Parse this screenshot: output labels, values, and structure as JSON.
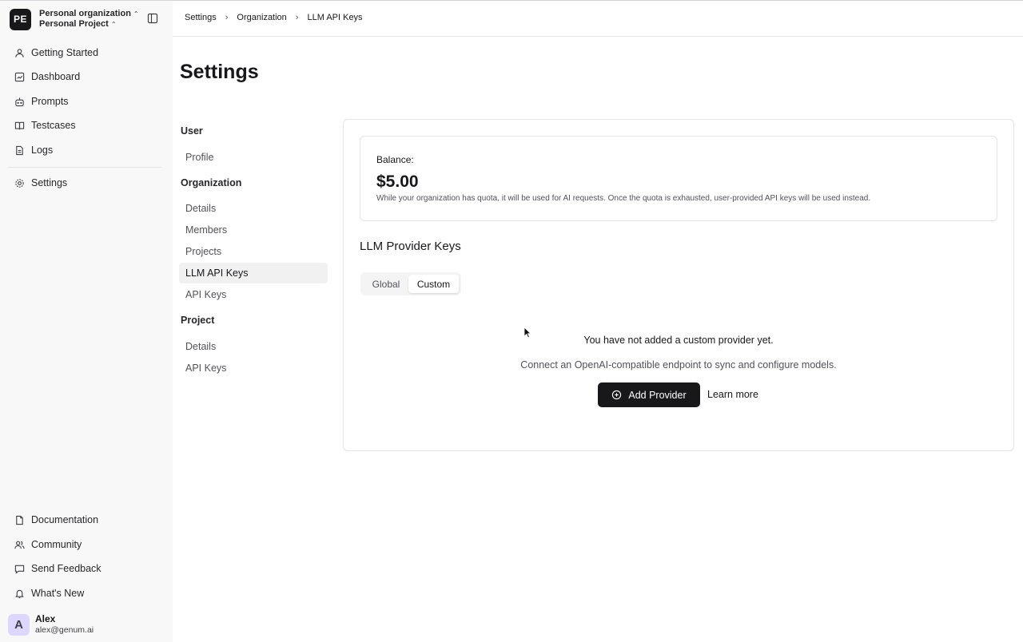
{
  "org": {
    "avatar": "PE",
    "organization": "Personal organization",
    "project": "Personal Project"
  },
  "sidebar": {
    "items": [
      {
        "label": "Getting Started",
        "icon": "user-icon"
      },
      {
        "label": "Dashboard",
        "icon": "dashboard-icon"
      },
      {
        "label": "Prompts",
        "icon": "bot-icon"
      },
      {
        "label": "Testcases",
        "icon": "book-icon"
      },
      {
        "label": "Logs",
        "icon": "file-text-icon"
      },
      {
        "label": "Settings",
        "icon": "gear-icon"
      }
    ],
    "footer": [
      {
        "label": "Documentation",
        "icon": "file-icon"
      },
      {
        "label": "Community",
        "icon": "users-icon"
      },
      {
        "label": "Send Feedback",
        "icon": "message-icon"
      },
      {
        "label": "What's New",
        "icon": "bell-icon"
      }
    ]
  },
  "user": {
    "initial": "A",
    "name": "Alex",
    "email": "alex@genum.ai"
  },
  "breadcrumb": [
    "Settings",
    "Organization",
    "LLM API Keys"
  ],
  "page": {
    "title": "Settings"
  },
  "settings_nav": {
    "user_heading": "User",
    "user_items": [
      "Profile"
    ],
    "org_heading": "Organization",
    "org_items": [
      "Details",
      "Members",
      "Projects",
      "LLM API Keys",
      "API Keys"
    ],
    "project_heading": "Project",
    "project_items": [
      "Details",
      "API Keys"
    ],
    "active": "LLM API Keys"
  },
  "balance": {
    "label": "Balance:",
    "amount": "$5.00",
    "note": "While your organization has quota, it will be used for AI requests. Once the quota is exhausted, user-provided API keys will be used instead."
  },
  "providers": {
    "title": "LLM Provider Keys",
    "tabs": [
      "Global",
      "Custom"
    ],
    "active_tab": "Custom",
    "empty_title": "You have not added a custom provider yet.",
    "empty_subtitle": "Connect an OpenAI-compatible endpoint to sync and configure models.",
    "add_button": "Add Provider",
    "learn_more": "Learn more"
  }
}
